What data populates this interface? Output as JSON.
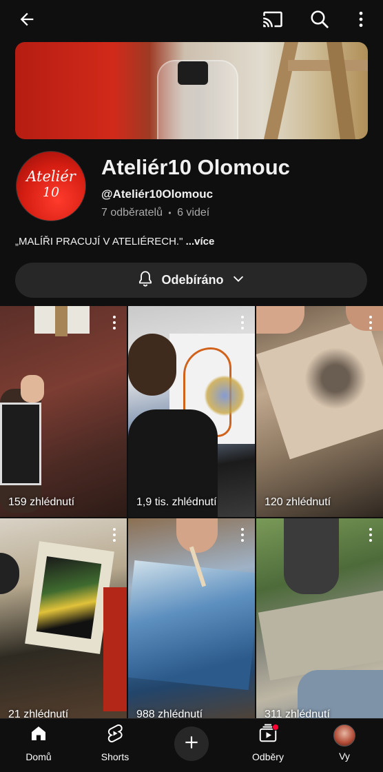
{
  "topbar": {
    "icons": [
      "back-arrow-icon",
      "cast-icon",
      "search-icon",
      "more-vert-icon"
    ]
  },
  "channel": {
    "name": "Ateliér10 Olomouc",
    "handle": "@Ateliér10Olomouc",
    "subscribers": "7 odběratelů",
    "separator": "•",
    "videos": "6 videí",
    "description": "„MALÍŘI PRACUJÍ V ATELIÉRECH.\"",
    "more_link": "...více",
    "avatar_text_line1": "Ateliér",
    "avatar_text_line2": "10"
  },
  "subscribe": {
    "label": "Odebíráno"
  },
  "shorts": [
    {
      "views": "159 zhlédnutí"
    },
    {
      "views": "1,9 tis. zhlédnutí"
    },
    {
      "views": "120 zhlédnutí"
    },
    {
      "views": "21 zhlédnutí"
    },
    {
      "views": "988 zhlédnutí"
    },
    {
      "views": "311 zhlédnutí"
    }
  ],
  "nav": {
    "home": "Domů",
    "shorts": "Shorts",
    "subscriptions": "Odběry",
    "you": "Vy"
  },
  "colors": {
    "background": "#0f0f0f",
    "surface": "#272727",
    "secondary_text": "#aaaaaa",
    "notification": "#ff0033"
  }
}
